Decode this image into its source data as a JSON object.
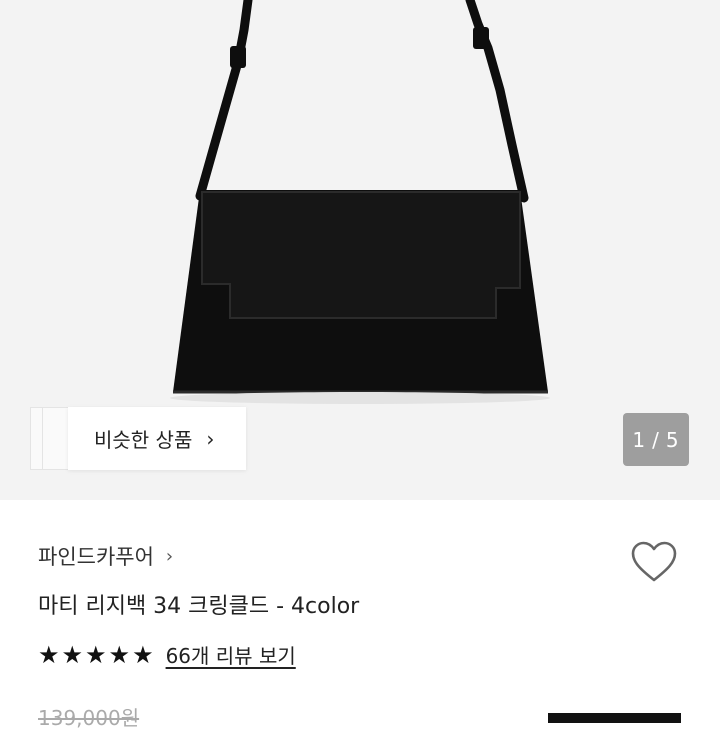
{
  "gallery": {
    "similar_label": "비슷한 상품",
    "chevron": "›",
    "counter_current": "1",
    "counter_sep": "/",
    "counter_total": "5"
  },
  "product": {
    "brand": "파인드카푸어",
    "brand_chevron": "›",
    "title": "마티 리지백 34 크링클드 - 4color",
    "rating": 5,
    "reviews_label": "66개 리뷰 보기",
    "original_price": "139,000원"
  },
  "colors": {
    "hero_bg": "#f3f3f3",
    "bag": "#0e0e0e",
    "counter_bg": "#9e9e9e",
    "accent": "#111111"
  },
  "icons": {
    "heart": "heart-icon",
    "star": "star-icon",
    "chevron": "chevron-right-icon"
  }
}
